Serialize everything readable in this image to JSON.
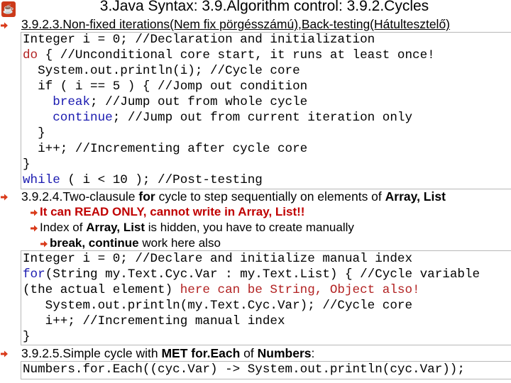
{
  "slide": {
    "title": "3.Java Syntax: 3.9.Algorithm control: 3.9.2.Cycles",
    "logo_icon": "java-cup-icon",
    "bullet_icon": "arrow-right-icon",
    "colors": {
      "bullet": "#d93a1a",
      "keyword": "#b22222",
      "control": "#1a1ab0",
      "warning": "#c00000"
    }
  },
  "section1": {
    "heading": "3.9.2.3.Non-fixed iterations(Nem fix pörgésszámú),Back-testing(Hátultesztelő)",
    "code": [
      "Integer i = 0; //Declaration and initialization",
      "do { //Unconditional core start, it runs at least once!",
      "  System.out.println(i); //Cycle core",
      "  if ( i == 5 ) { //Jomp out condition",
      "    break; //Jump out from whole cycle",
      "    continue; //Jump out from current iteration only",
      "  }",
      "  i++; //Incrementing after cycle core",
      "}",
      "while ( i < 10 ); //Post-testing"
    ]
  },
  "section2": {
    "heading_pre": "3.9.2.4.Two-clausule ",
    "heading_for": "for",
    "heading_mid": " cycle to step sequentially on elements of ",
    "heading_array": "Array, List",
    "subs": {
      "s1": "It can READ ONLY, cannot write in Array, List!!",
      "s2_pre": "Index of ",
      "s2_bold": "Array, List",
      "s2_post": " is hidden, you have to create manually",
      "s3_bold": "break, continue",
      "s3_post": " work here also"
    },
    "code": {
      "l1": "Integer i = 0; //Declare and initialize manual index",
      "l2_kw": "for",
      "l2_rest": "(String my.Text.Cyc.Var : my.Text.List) { //Cycle variable",
      "l3_pre": "(the actual element) ",
      "l3_red": "here can be String, Object also!",
      "l4": "   System.out.println(my.Text.Cyc.Var); //Cycle core",
      "l5": "   i++; //Incrementing manual index",
      "l6": "}"
    }
  },
  "section3": {
    "heading_pre": "3.9.2.5.Simple cycle with ",
    "heading_bold": "MET for.Each",
    "heading_mid": " of ",
    "heading_bold2": "Numbers",
    "heading_post": ":",
    "code": "Numbers.for.Each((cyc.Var) -> System.out.println(cyc.Var));"
  }
}
